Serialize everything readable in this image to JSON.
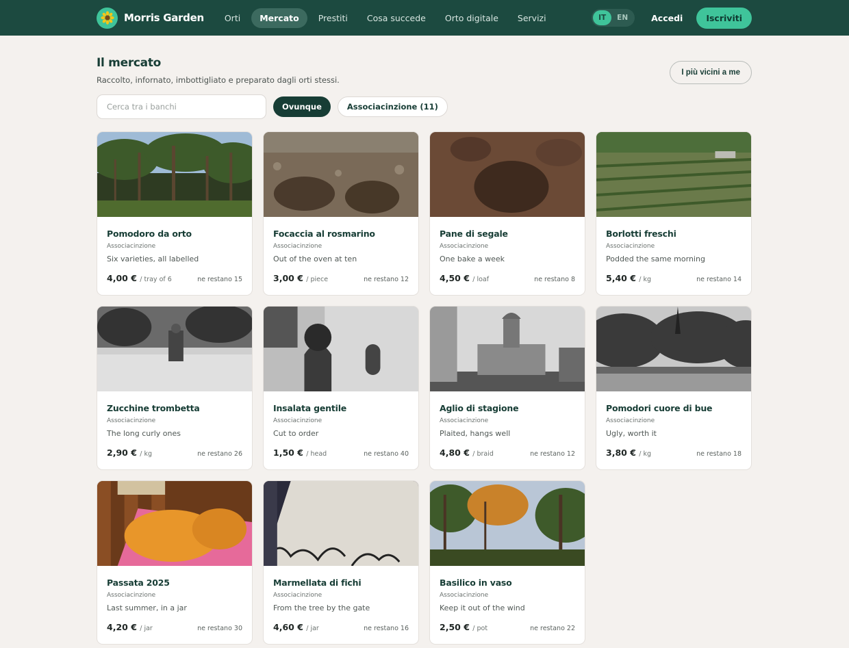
{
  "nav": {
    "brand": "Morris Garden",
    "links": [
      {
        "label": "Orti",
        "active": false
      },
      {
        "label": "Mercato",
        "active": true
      },
      {
        "label": "Prestiti",
        "active": false
      },
      {
        "label": "Cosa succede",
        "active": false
      },
      {
        "label": "Orto digitale",
        "active": false
      },
      {
        "label": "Servizi",
        "active": false
      }
    ],
    "lang_it": "IT",
    "lang_en": "EN",
    "login": "Accedi",
    "signup": "Iscriviti"
  },
  "header": {
    "title": "Il mercato",
    "subtitle": "Raccolto, infornato, imbottigliato e preparato dagli orti stessi.",
    "nearby_button": "I più vicini a me"
  },
  "filters": {
    "search_placeholder": "Cerca tra i banchi",
    "chip_anywhere": "Ovunque",
    "chip_association": "Associacinzione (11)"
  },
  "products": [
    {
      "name": "Pomodoro da orto",
      "shop": "Associacinzione",
      "desc": "Six varieties, all labelled",
      "price": "4,00 €",
      "unit": "/ tray of 6",
      "stock": "ne restano 15",
      "photo": "forest"
    },
    {
      "name": "Focaccia al rosmarino",
      "shop": "Associacinzione",
      "desc": "Out of the oven at ten",
      "price": "3,00 €",
      "unit": "/ piece",
      "stock": "ne restano 12",
      "photo": "soil-holes"
    },
    {
      "name": "Pane di segale",
      "shop": "Associacinzione",
      "desc": "One bake a week",
      "price": "4,50 €",
      "unit": "/ loaf",
      "stock": "ne restano 8",
      "photo": "dirt-pit"
    },
    {
      "name": "Borlotti freschi",
      "shop": "Associacinzione",
      "desc": "Podded the same morning",
      "price": "5,40 €",
      "unit": "/ kg",
      "stock": "ne restano 14",
      "photo": "garden-rows"
    },
    {
      "name": "Zucchine trombetta",
      "shop": "Associacinzione",
      "desc": "The long curly ones",
      "price": "2,90 €",
      "unit": "/ kg",
      "stock": "ne restano 26",
      "photo": "bw-field"
    },
    {
      "name": "Insalata gentile",
      "shop": "Associacinzione",
      "desc": "Cut to order",
      "price": "1,50 €",
      "unit": "/ head",
      "stock": "ne restano 40",
      "photo": "bw-building"
    },
    {
      "name": "Aglio di stagione",
      "shop": "Associacinzione",
      "desc": "Plaited, hangs well",
      "price": "4,80 €",
      "unit": "/ braid",
      "stock": "ne restano 12",
      "photo": "bw-townhall"
    },
    {
      "name": "Pomodori cuore di bue",
      "shop": "Associacinzione",
      "desc": "Ugly, worth it",
      "price": "3,80 €",
      "unit": "/ kg",
      "stock": "ne restano 18",
      "photo": "bw-pond"
    },
    {
      "name": "Passata 2025",
      "shop": "Associacinzione",
      "desc": "Last summer, in a jar",
      "price": "4,20 €",
      "unit": "/ jar",
      "stock": "ne restano 30",
      "photo": "toast"
    },
    {
      "name": "Marmellata di fichi",
      "shop": "Associacinzione",
      "desc": "From the tree by the gate",
      "price": "4,60 €",
      "unit": "/ jar",
      "stock": "ne restano 16",
      "photo": "book-page"
    },
    {
      "name": "Basilico in vaso",
      "shop": "Associacinzione",
      "desc": "Keep it out of the wind",
      "price": "2,50 €",
      "unit": "/ pot",
      "stock": "ne restano 22",
      "photo": "autumn-forest"
    }
  ],
  "colors": {
    "nav_bg": "#1c4a40",
    "accent": "#3fc49a",
    "title": "#173d35",
    "page_bg": "#f4f1ee"
  }
}
